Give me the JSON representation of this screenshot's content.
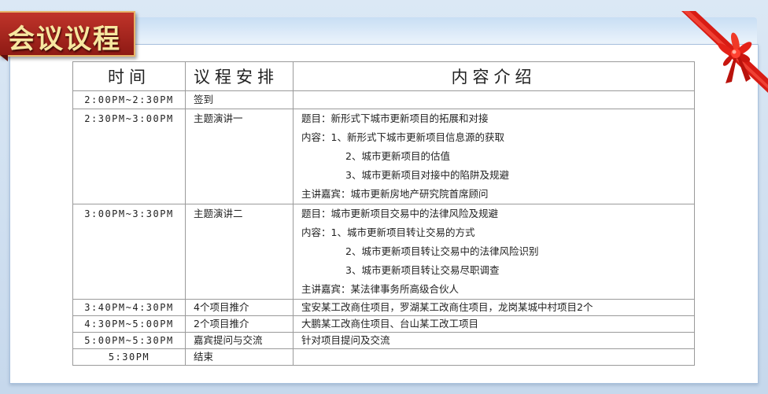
{
  "banner": {
    "title": "会议议程"
  },
  "table": {
    "headers": {
      "time": "时间",
      "agenda": "议程安排",
      "content": "内容介绍"
    },
    "rows": [
      {
        "time": "2:00PM~2:30PM",
        "agenda": "签到",
        "content": []
      },
      {
        "time": "2:30PM~3:00PM",
        "agenda": "主题演讲一",
        "content": [
          "题目：新形式下城市更新项目的拓展和对接",
          "内容：1、新形式下城市更新项目信息源的获取",
          "2、城市更新项目的估值",
          "3、城市更新项目对接中的陷阱及规避",
          "主讲嘉宾：城市更新房地产研究院首席顾问"
        ]
      },
      {
        "time": "3:00PM~3:30PM",
        "agenda": "主题演讲二",
        "content": [
          "题目：城市更新项目交易中的法律风险及规避",
          "内容：1、城市更新项目转让交易的方式",
          "2、城市更新项目转让交易中的法律风险识别",
          "3、城市更新项目转让交易尽职调查",
          "主讲嘉宾：某法律事务所高级合伙人"
        ]
      },
      {
        "time": "3:40PM~4:30PM",
        "agenda": "4个项目推介",
        "content": [
          "宝安某工改商住项目，罗湖某工改商住项目，龙岗某城中村项目2个"
        ]
      },
      {
        "time": "4:30PM~5:00PM",
        "agenda": "2个项目推介",
        "content": [
          "大鹏某工改商住项目、台山某工改工项目"
        ]
      },
      {
        "time": "5:00PM~5:30PM",
        "agenda": "嘉宾提问与交流",
        "content": [
          "针对项目提问及交流"
        ]
      },
      {
        "time": "5:30PM",
        "agenda": "结束",
        "content": []
      }
    ]
  },
  "colors": {
    "banner": "#a8261e",
    "banner_text": "#f7e7a0",
    "ribbon": "#e0201a",
    "panel_bg": "#c6d8ec"
  }
}
